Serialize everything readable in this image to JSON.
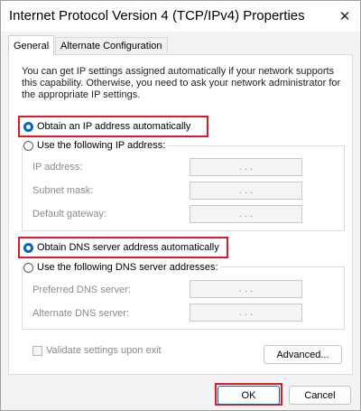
{
  "window": {
    "title": "Internet Protocol Version 4 (TCP/IPv4) Properties"
  },
  "tabs": [
    {
      "label": "General",
      "active": true
    },
    {
      "label": "Alternate Configuration",
      "active": false
    }
  ],
  "general": {
    "description": "You can get IP settings assigned automatically if your network supports this capability. Otherwise, you need to ask your network administrator for the appropriate IP settings.",
    "ip": {
      "auto_label": "Obtain an IP address automatically",
      "manual_label": "Use the following IP address:",
      "fields": [
        {
          "label": "IP address:",
          "value": ". . ."
        },
        {
          "label": "Subnet mask:",
          "value": ". . ."
        },
        {
          "label": "Default gateway:",
          "value": ". . ."
        }
      ]
    },
    "dns": {
      "auto_label": "Obtain DNS server address automatically",
      "manual_label": "Use the following DNS server addresses:",
      "fields": [
        {
          "label": "Preferred DNS server:",
          "value": ". . ."
        },
        {
          "label": "Alternate DNS server:",
          "value": ". . ."
        }
      ]
    },
    "validate_label": "Validate settings upon exit",
    "advanced_label": "Advanced..."
  },
  "buttons": {
    "ok": "OK",
    "cancel": "Cancel"
  },
  "colors": {
    "accent": "#0067c0",
    "highlight": "#e0192a"
  }
}
